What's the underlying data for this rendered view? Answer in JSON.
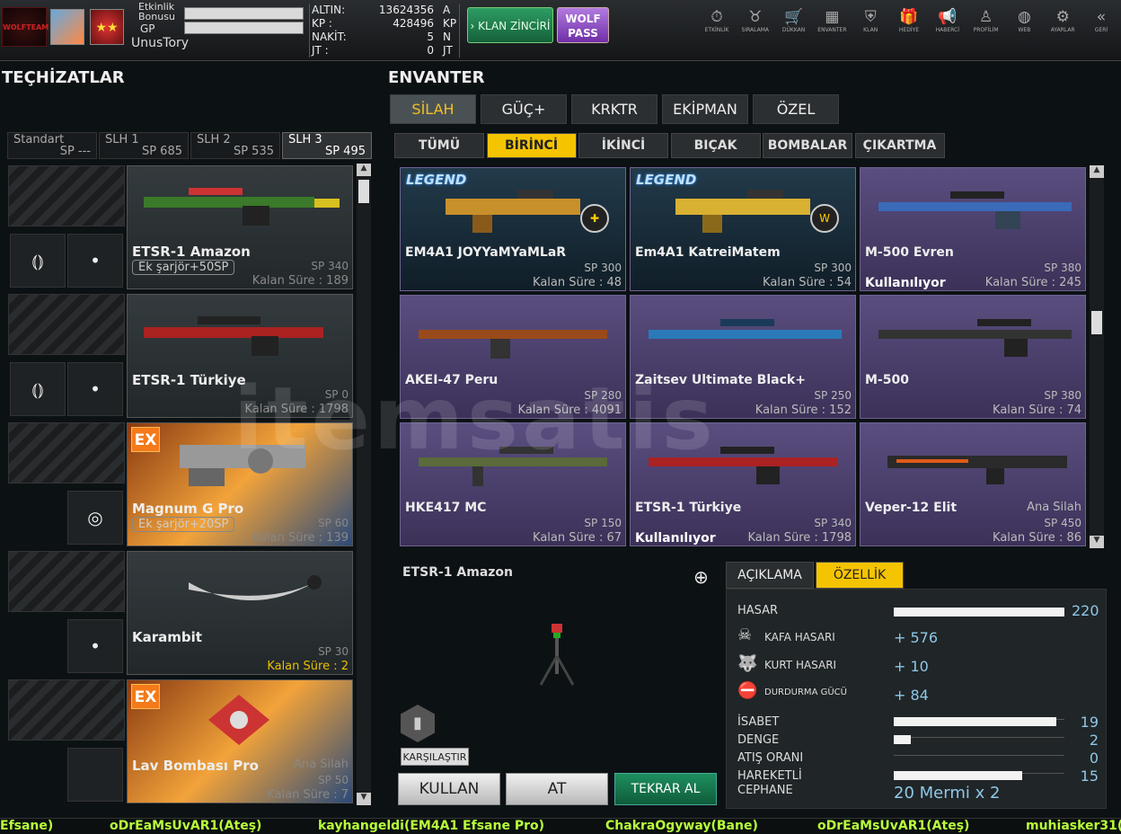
{
  "header": {
    "logo_text": "WOLFTEAM",
    "etkinlik_label": "Etkinlik Bonusu",
    "gp_label": "GP",
    "username": "UnusTory",
    "currency": [
      {
        "label": "ALTIN:",
        "value": "13624356",
        "unit": "A"
      },
      {
        "label": "KP :",
        "value": "428496",
        "unit": "KP"
      },
      {
        "label": "NAKİT:",
        "value": "5",
        "unit": "N"
      },
      {
        "label": "JT :",
        "value": "0",
        "unit": "JT"
      }
    ],
    "klan_zinciri": "› KLAN ZİNCİRİ",
    "wolf_pass": "WOLF PASS",
    "nav": [
      {
        "label": "ETKİNLİK",
        "icon": "stopwatch-icon"
      },
      {
        "label": "SIRALAMA",
        "icon": "wolf-icon"
      },
      {
        "label": "DÜKKAN",
        "icon": "cart-icon"
      },
      {
        "label": "ENVANTER",
        "icon": "inventory-icon"
      },
      {
        "label": "KLAN",
        "icon": "shield-icon"
      },
      {
        "label": "HEDİYE",
        "icon": "gift-icon"
      },
      {
        "label": "HABERCİ",
        "icon": "megaphone-icon"
      },
      {
        "label": "PROFİLİM",
        "icon": "profile-icon"
      },
      {
        "label": "WEB",
        "icon": "globe-icon"
      },
      {
        "label": "AYARLAR",
        "icon": "gear-icon"
      },
      {
        "label": "GERİ",
        "icon": "back-icon"
      }
    ]
  },
  "left": {
    "title": "TEÇHİZATLAR",
    "tabs": [
      {
        "label": "Standart",
        "sp": "SP ---"
      },
      {
        "label": "SLH 1",
        "sp": "SP 685"
      },
      {
        "label": "SLH 2",
        "sp": "SP 535"
      },
      {
        "label": "SLH 3",
        "sp": "SP 495"
      }
    ],
    "cards": [
      {
        "name": "ETSR-1 Amazon",
        "extra": "Ek şarjör+50SP",
        "sp": "SP 340",
        "kalan": "Kalan Süre : 189"
      },
      {
        "name": "ETSR-1 Türkiye",
        "sp": "SP 0",
        "kalan": "Kalan Süre : 1798"
      },
      {
        "name": "Magnum G Pro",
        "extra": "Ek şarjör+20SP",
        "sp": "SP 60",
        "kalan": "Kalan Süre : 139",
        "ex": "EX"
      },
      {
        "name": "Karambit",
        "sp": "SP 30",
        "kalan": "Kalan Süre : 2"
      },
      {
        "name": "Lav Bombası Pro",
        "ana": "Ana Silah",
        "sp": "SP 50",
        "kalan": "Kalan Süre : 7",
        "ex": "EX"
      }
    ]
  },
  "right": {
    "title": "ENVANTER",
    "tabs": [
      "SİLAH",
      "GÜÇ+",
      "KRKTR",
      "EKİPMAN",
      "ÖZEL"
    ],
    "subtabs": [
      "TÜMÜ",
      "BİRİNCİ",
      "İKİNCİ",
      "BIÇAK",
      "BOMBALAR",
      "ÇIKARTMA"
    ],
    "items": [
      {
        "name": "EM4A1 JOYYaMYaMLaR",
        "sp": "SP 300",
        "kalan": "Kalan Süre : 48",
        "legend": "LEGEND"
      },
      {
        "name": "Em4A1 KatreiMatem",
        "sp": "SP 300",
        "kalan": "Kalan Süre : 54",
        "legend": "LEGEND"
      },
      {
        "name": "M-500 Evren",
        "sp": "SP 380",
        "kalan": "Kalan Süre : 245",
        "status": "Kullanılıyor"
      },
      {
        "name": "AKEI-47 Peru",
        "sp": "SP 280",
        "kalan": "Kalan Süre : 4091"
      },
      {
        "name": "Zaitsev Ultimate Black+",
        "sp": "SP 250",
        "kalan": "Kalan Süre : 152"
      },
      {
        "name": "M-500",
        "sp": "SP 380",
        "kalan": "Kalan Süre : 74"
      },
      {
        "name": "HKE417 MC",
        "sp": "SP 150",
        "kalan": "Kalan Süre : 67"
      },
      {
        "name": "ETSR-1 Türkiye",
        "sp": "SP 340",
        "kalan": "Kalan Süre : 1798",
        "status": "Kullanılıyor"
      },
      {
        "name": "Veper-12 Elit",
        "ana": "Ana Silah",
        "sp": "SP 450",
        "kalan": "Kalan Süre : 86"
      }
    ]
  },
  "detail": {
    "selected": "ETSR-1 Amazon",
    "compare": "KARŞILAŞTIR",
    "tabs": [
      "AÇIKLAMA",
      "ÖZELLİK"
    ],
    "hasar": {
      "label": "HASAR",
      "value": "220",
      "fill": 1.0
    },
    "kafa": {
      "label": "KAFA HASARI",
      "value": "+ 576"
    },
    "kurt": {
      "label": "KURT HASARI",
      "value": "+ 10"
    },
    "durdurma": {
      "label": "DURDURMA GÜCÜ",
      "value": "+ 84"
    },
    "stats": [
      {
        "label": "İSABET",
        "value": "19",
        "fill": 0.95
      },
      {
        "label": "DENGE",
        "value": "2",
        "fill": 0.1
      },
      {
        "label": "ATIŞ ORANI",
        "value": "0",
        "fill": 0.0
      },
      {
        "label": "HAREKETLİ",
        "value": "15",
        "fill": 0.75
      }
    ],
    "cephane": {
      "label": "CEPHANE",
      "value": "20 Mermi x 2"
    },
    "buttons": [
      "KULLAN",
      "AT",
      "TEKRAR AL"
    ]
  },
  "ticker": [
    "Efsane)",
    "oDrEaMsUvAR1(Ateş)",
    "kayhangeldi(EM4A1 Efsane Pro)",
    "ChakraOgyway(Bane)",
    "oDrEaMsUvAR1(Ateş)",
    "muhiasker31("
  ],
  "watermark": "itemsatis",
  "colors": {
    "accent": "#f5c400",
    "card_purple": "#5a4e80",
    "ticker": "#b8ff3a"
  }
}
